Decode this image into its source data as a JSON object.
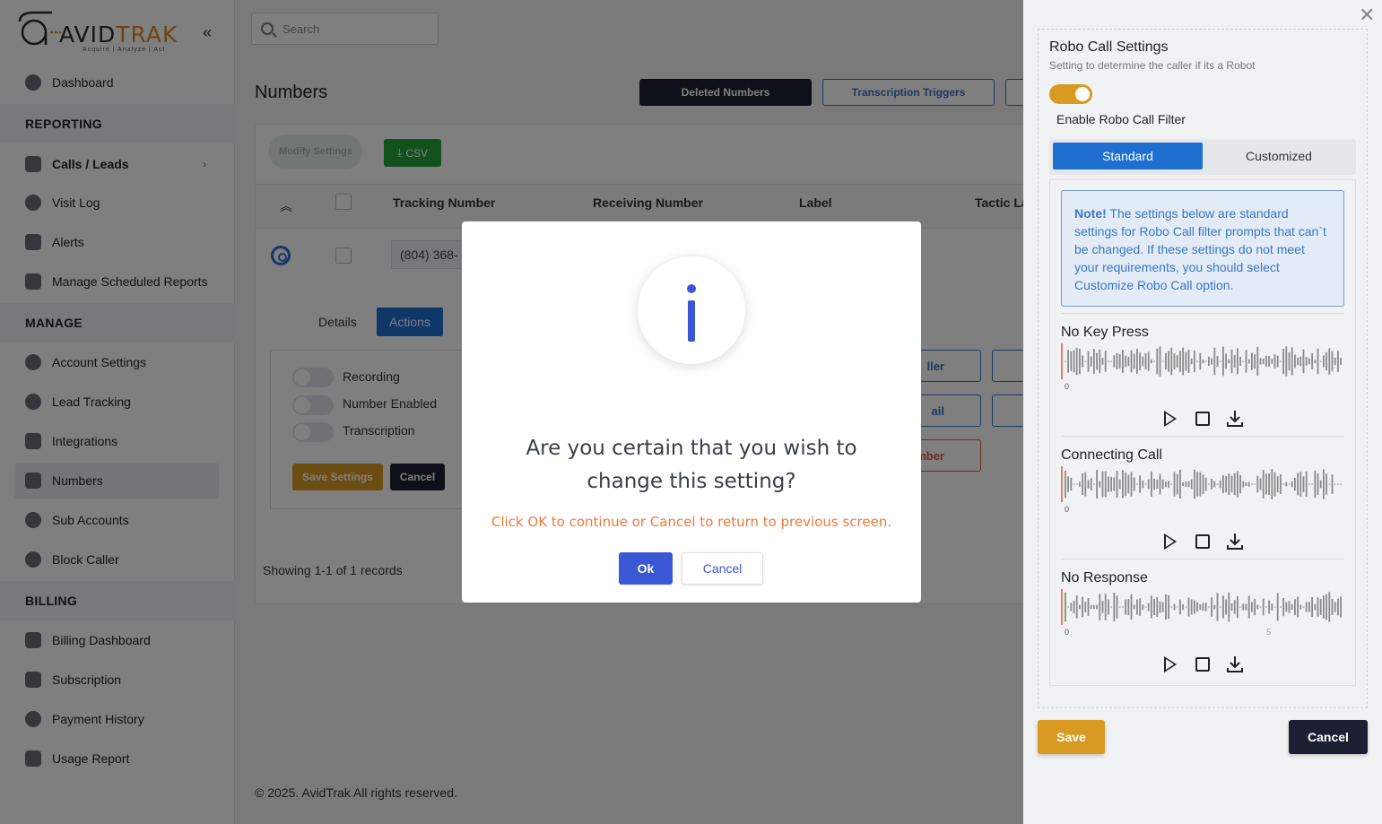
{
  "logo": {
    "brand": "AVIDTRAK",
    "brand_prefix": "AVID",
    "brand_suffix": "TRAK",
    "tagline": "Acquire  |  Analyze  |  Act"
  },
  "sidebar": {
    "items": [
      {
        "label": "Dashboard",
        "icon": "dashboard-icon"
      },
      {
        "label": "Calls / Leads",
        "icon": "phone-icon"
      },
      {
        "label": "Visit Log",
        "icon": "globe-icon"
      },
      {
        "label": "Alerts",
        "icon": "alerts-icon"
      },
      {
        "label": "Manage Scheduled Reports",
        "icon": "calendar-icon"
      },
      {
        "label": "Account Settings",
        "icon": "gear-icon"
      },
      {
        "label": "Lead Tracking",
        "icon": "pie-chart-icon"
      },
      {
        "label": "Integrations",
        "icon": "integrations-icon"
      },
      {
        "label": "Numbers",
        "icon": "hash-icon"
      },
      {
        "label": "Sub Accounts",
        "icon": "users-icon"
      },
      {
        "label": "Block Caller",
        "icon": "block-user-icon"
      },
      {
        "label": "Billing Dashboard",
        "icon": "card-icon"
      },
      {
        "label": "Subscription",
        "icon": "subscription-icon"
      },
      {
        "label": "Payment History",
        "icon": "dollar-icon"
      },
      {
        "label": "Usage Report",
        "icon": "report-icon"
      }
    ],
    "sections": {
      "reporting": "REPORTING",
      "manage": "MANAGE",
      "billing": "BILLING"
    }
  },
  "search": {
    "placeholder": "Search"
  },
  "page": {
    "title": "Numbers",
    "deleted_numbers": "Deleted Numbers",
    "transcription_triggers": "Transcription Triggers",
    "modify_settings": "Modify Settings",
    "csv": "CSV",
    "columns": [
      "Tracking Number",
      "Receiving Number",
      "Label",
      "Tactic La"
    ],
    "tracking_value": "(804) 368-",
    "tab_details": "Details",
    "tab_actions": "Actions",
    "toggles": [
      "Recording",
      "Number Enabled",
      "Transcription"
    ],
    "save_settings": "Save Settings",
    "cancel": "Cancel",
    "right_btn_1": "ller",
    "right_btn_2": "ail",
    "right_btn_3": "mber",
    "records": "Showing 1-1 of 1 records",
    "footer": "© 2025. AvidTrak All rights reserved."
  },
  "modal": {
    "title": "Are you certain that you wish to change this setting?",
    "subtitle": "Click OK to continue or Cancel to return to previous screen.",
    "ok": "Ok",
    "cancel": "Cancel"
  },
  "panel": {
    "title": "Robo Call Settings",
    "subtitle": "Setting to determine the caller if its a Robot",
    "enable_label": "Enable Robo Call Filter",
    "standard": "Standard",
    "customized": "Customized",
    "note_bold": "Note!",
    "note_text": " The settings below are standard settings for Robo Call filter prompts that can`t be changed. If these settings do not meet your requirements, you should select Customize Robo Call option.",
    "recordings": [
      {
        "title": "No Key Press",
        "axis_start": "0"
      },
      {
        "title": "Connecting Call",
        "axis_start": "0"
      },
      {
        "title": "No Response",
        "axis_start": "0",
        "axis_mark": "5"
      }
    ],
    "save": "Save",
    "cancel": "Cancel"
  },
  "colors": {
    "accent": "#d99a22",
    "primary": "#1e6fd0",
    "dark": "#1d2033",
    "modal_primary": "#3a57d6",
    "warning_text": "#f0773c"
  }
}
